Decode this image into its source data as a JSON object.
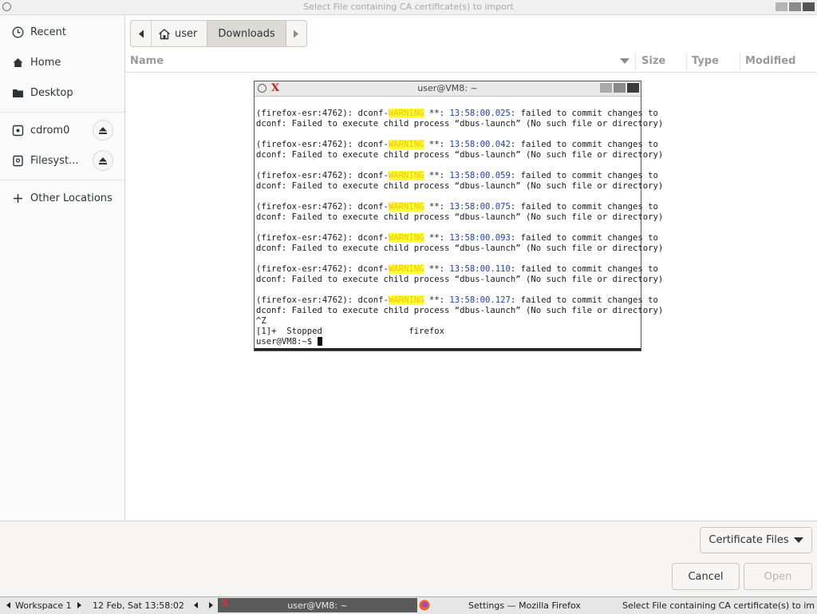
{
  "window": {
    "title": "Select File containing CA certificate(s) to import"
  },
  "sidebar": {
    "items": [
      {
        "label": "Recent",
        "icon": "clock-icon"
      },
      {
        "label": "Home",
        "icon": "home-icon"
      },
      {
        "label": "Desktop",
        "icon": "folder-icon"
      },
      {
        "label": "cdrom0",
        "icon": "disc-icon"
      },
      {
        "label": "Filesyst...",
        "icon": "drive-icon"
      },
      {
        "label": "Other Locations",
        "icon": "plus-icon"
      }
    ]
  },
  "pathbar": {
    "segments": [
      "user",
      "Downloads"
    ],
    "active": "Downloads"
  },
  "columns": {
    "name": "Name",
    "size": "Size",
    "type": "Type",
    "modified": "Modified"
  },
  "terminal": {
    "title": "user@VM8: ~",
    "warnings": [
      {
        "prefix": "(firefox-esr:4762): dconf-",
        "level": "WARNING",
        "sep": " **: ",
        "time": "13:58:00.025",
        "msg": ": failed to commit changes to",
        "line2": "dconf: Failed to execute child process “dbus-launch” (No such file or directory)"
      },
      {
        "prefix": "(firefox-esr:4762): dconf-",
        "level": "WARNING",
        "sep": " **: ",
        "time": "13:58:00.042",
        "msg": ": failed to commit changes to",
        "line2": "dconf: Failed to execute child process “dbus-launch” (No such file or directory)"
      },
      {
        "prefix": "(firefox-esr:4762): dconf-",
        "level": "WARNING",
        "sep": " **: ",
        "time": "13:58:00.059",
        "msg": ": failed to commit changes to",
        "line2": "dconf: Failed to execute child process “dbus-launch” (No such file or directory)"
      },
      {
        "prefix": "(firefox-esr:4762): dconf-",
        "level": "WARNING",
        "sep": " **: ",
        "time": "13:58:00.075",
        "msg": ": failed to commit changes to",
        "line2": "dconf: Failed to execute child process “dbus-launch” (No such file or directory)"
      },
      {
        "prefix": "(firefox-esr:4762): dconf-",
        "level": "WARNING",
        "sep": " **: ",
        "time": "13:58:00.093",
        "msg": ": failed to commit changes to",
        "line2": "dconf: Failed to execute child process “dbus-launch” (No such file or directory)"
      },
      {
        "prefix": "(firefox-esr:4762): dconf-",
        "level": "WARNING",
        "sep": " **: ",
        "time": "13:58:00.110",
        "msg": ": failed to commit changes to",
        "line2": "dconf: Failed to execute child process “dbus-launch” (No such file or directory)"
      },
      {
        "prefix": "(firefox-esr:4762): dconf-",
        "level": "WARNING",
        "sep": " **: ",
        "time": "13:58:00.127",
        "msg": ": failed to commit changes to",
        "line2": "dconf: Failed to execute child process “dbus-launch” (No such file or directory)"
      }
    ],
    "ctrl_z": "^Z",
    "job_line": "[1]+  Stopped                 firefox",
    "prompt": "user@VM8:~$ "
  },
  "filter": {
    "selected": "Certificate Files"
  },
  "buttons": {
    "cancel": "Cancel",
    "open": "Open"
  },
  "taskbar": {
    "workspace": "Workspace 1",
    "datetime": "12 Feb, Sat 13:58:02",
    "active_task": "user@VM8: ~",
    "task2": "Settings — Mozilla Firefox",
    "task3": "Select File containing CA certificate(s) to im"
  },
  "colors": {
    "warning_fg": "#f5c400",
    "warning_bg": "#ffff3c",
    "timestamp": "#1f3fa8",
    "selected_path": "#dcdad5"
  }
}
